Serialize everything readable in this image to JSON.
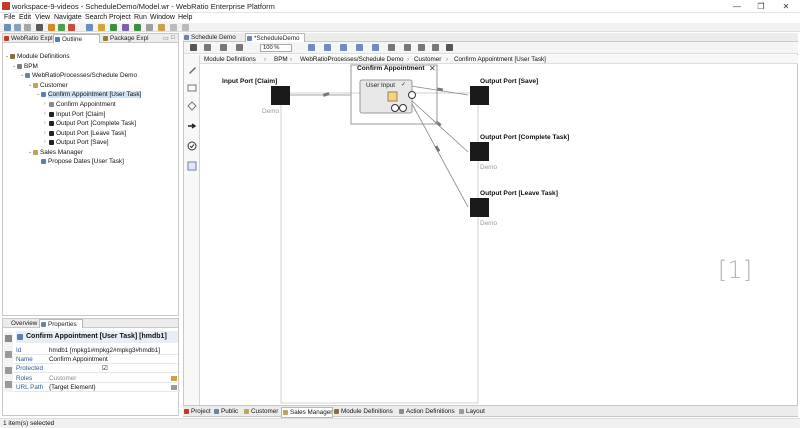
{
  "window": {
    "title": "workspace-9-videos - ScheduleDemo/Model.wr - WebRatio Enterprise Platform",
    "minimize": "—",
    "maximize": "❐",
    "close": "✕"
  },
  "menu": [
    "File",
    "Edit",
    "View",
    "Navigate",
    "Search",
    "Project",
    "Run",
    "Window",
    "Help"
  ],
  "left_tabs": [
    {
      "label": "WebRatio Expl"
    },
    {
      "label": "Outline",
      "active": true
    },
    {
      "label": "Package Expl"
    }
  ],
  "tree": [
    {
      "label": "Module Definitions",
      "level": 0
    },
    {
      "label": "BPM",
      "level": 1
    },
    {
      "label": "WebRatioProcesses/Schedule Demo",
      "level": 2
    },
    {
      "label": "Customer",
      "level": 3
    },
    {
      "label": "Confirm Appointment [User Task]",
      "level": 4,
      "selected": true
    },
    {
      "label": "Confirm Appointment",
      "level": 5
    },
    {
      "label": "Input Port [Claim]",
      "level": 5
    },
    {
      "label": "Output Port [Complete Task]",
      "level": 5
    },
    {
      "label": "Output Port [Leave Task]",
      "level": 5
    },
    {
      "label": "Output Port [Save]",
      "level": 5
    },
    {
      "label": "Sales Manager",
      "level": 3
    },
    {
      "label": "Propose Dates [User Task]",
      "level": 4
    }
  ],
  "props_tabs": [
    {
      "label": "Overview"
    },
    {
      "label": "Properties",
      "active": true
    }
  ],
  "props_title": "Confirm Appointment [User Task] [hmdb1]",
  "props": [
    {
      "key": "Id",
      "value": "hmdb1  [mpkg1#mpkg2#mpkg3#hmdb1]"
    },
    {
      "key": "Name",
      "value": "Confirm Appointment"
    },
    {
      "key": "Protected",
      "value": "☑"
    },
    {
      "key": "Roles",
      "value": "Customer"
    },
    {
      "key": "URL Path",
      "value": "{Target Element}"
    }
  ],
  "editor_tabs": [
    {
      "label": "Schedule Demo"
    },
    {
      "label": "*ScheduleDemo",
      "active": true
    }
  ],
  "zoom": "100 %",
  "breadcrumb": [
    "Module Definitions",
    "BPM",
    "WebRatioProcesses/Schedule Demo",
    "Customer",
    "Confirm Appointment [User Task]"
  ],
  "diagram": {
    "input_port": {
      "label": "Input Port [Claim]",
      "sub": "Demo"
    },
    "task": {
      "title": "Confirm Appointment",
      "inner": "User Input"
    },
    "out_save": {
      "label": "Output Port [Save]"
    },
    "out_complete": {
      "label": "Output Port [Complete Task]",
      "sub": "Demo"
    },
    "out_leave": {
      "label": "Output Port [Leave Task]",
      "sub": "Demo"
    },
    "watermark": "[1]"
  },
  "bottom_tabs": [
    "Project",
    "Public",
    "Customer",
    "Sales Manager",
    "Module Definitions",
    "Action Definitions",
    "Layout"
  ],
  "status": "1 item(s) selected",
  "colors": {
    "accent": "#2b5797",
    "selection": "#cde3f7",
    "port": "#1a1a1a"
  }
}
